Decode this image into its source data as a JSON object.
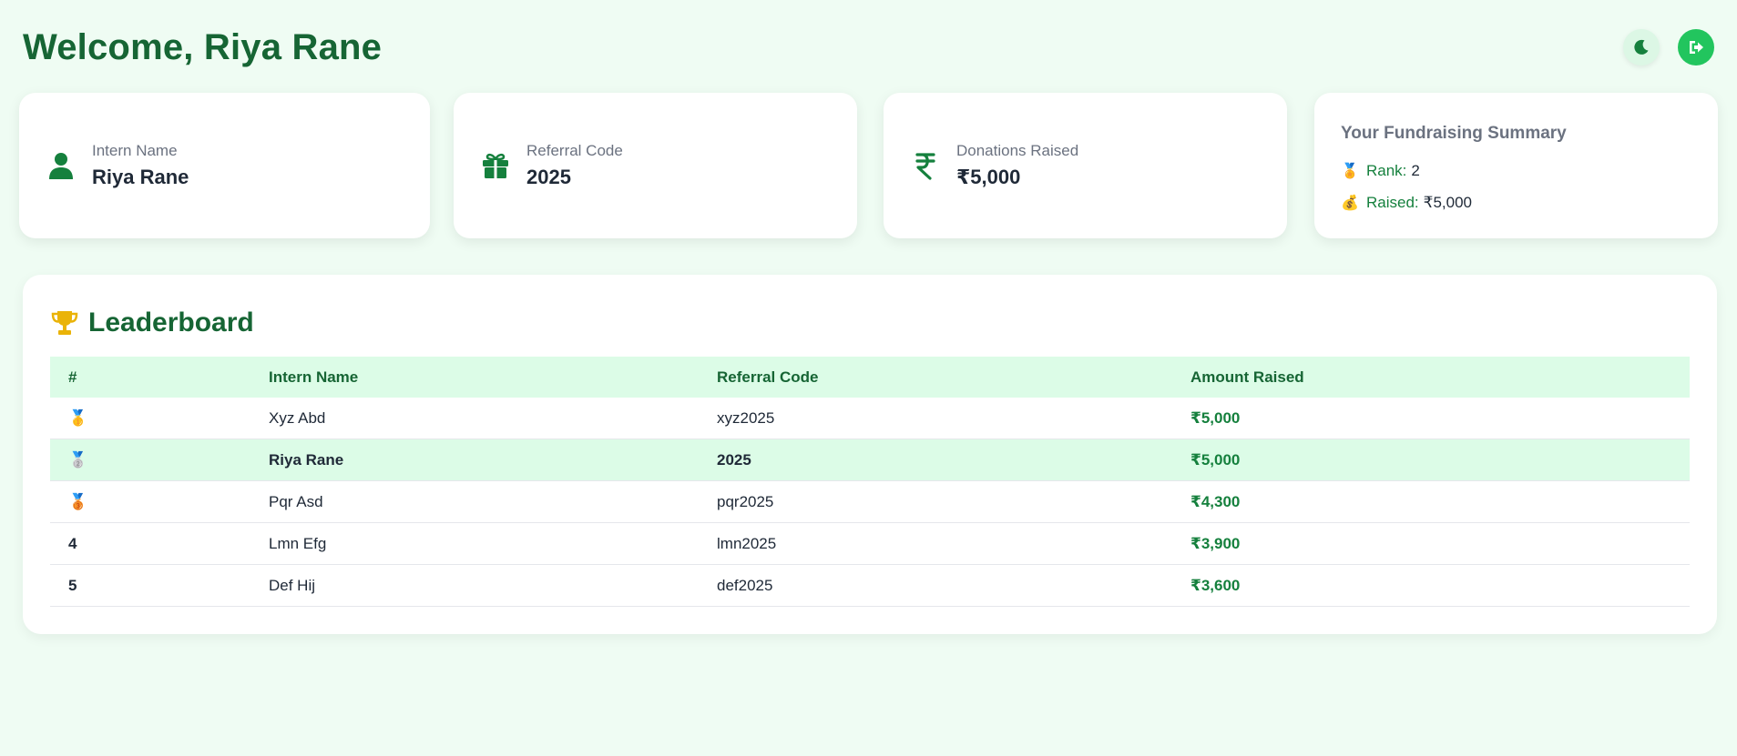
{
  "header": {
    "welcome": "Welcome, Riya Rane",
    "theme_icon": "moon-icon",
    "logout_icon": "logout-icon"
  },
  "cards": {
    "intern": {
      "label": "Intern Name",
      "value": "Riya Rane",
      "icon": "user-icon"
    },
    "referral": {
      "label": "Referral Code",
      "value": "2025",
      "icon": "gift-icon"
    },
    "donations": {
      "label": "Donations Raised",
      "value": "₹5,000",
      "icon": "rupee-icon"
    }
  },
  "summary": {
    "title": "Your Fundraising Summary",
    "rank_emoji": "🏅",
    "rank_label": "Rank:",
    "rank_value": "2",
    "raised_emoji": "💰",
    "raised_label": "Raised:",
    "raised_value": "₹5,000"
  },
  "leaderboard": {
    "icon": "trophy-icon",
    "title": "Leaderboard",
    "columns": [
      "#",
      "Intern Name",
      "Referral Code",
      "Amount Raised"
    ],
    "rows": [
      {
        "rank": "🥇",
        "name": "Xyz Abd",
        "code": "xyz2025",
        "amount": "₹5,000"
      },
      {
        "rank": "🥈",
        "name": "Riya Rane",
        "code": "2025",
        "amount": "₹5,000"
      },
      {
        "rank": "🥉",
        "name": "Pqr Asd",
        "code": "pqr2025",
        "amount": "₹4,300"
      },
      {
        "rank": "4",
        "name": "Lmn Efg",
        "code": "lmn2025",
        "amount": "₹3,900"
      },
      {
        "rank": "5",
        "name": "Def Hij",
        "code": "def2025",
        "amount": "₹3,600"
      }
    ]
  },
  "colors": {
    "accent": "#166534",
    "accent_light": "#dcfce7",
    "button_green": "#22c55e",
    "background": "#effcf3"
  }
}
